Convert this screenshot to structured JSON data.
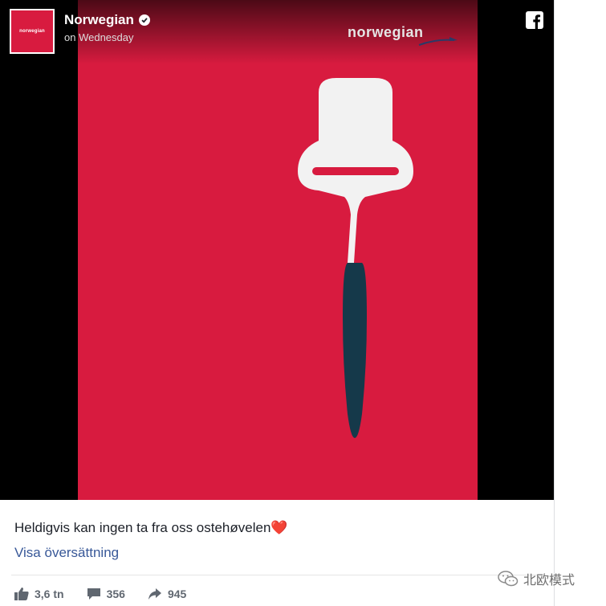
{
  "post": {
    "page_name": "Norwegian",
    "timestamp": "on Wednesday",
    "avatar_wordmark": "norwegian",
    "caption": "Heldigvis kan ingen ta fra oss ostehøvelen❤️",
    "translate_link": "Visa översättning",
    "likes": "3,6 tn",
    "comments": "356",
    "shares": "945"
  },
  "poster": {
    "brand_logo": "norwegian",
    "background_color": "#d81b3f",
    "handle_color": "#15394a"
  },
  "icons": {
    "facebook": "facebook-icon",
    "verified": "verified-badge-icon",
    "like": "thumbs-up-icon",
    "comment": "comment-bubble-icon",
    "share": "share-arrow-icon",
    "wechat": "wechat-icon"
  },
  "watermark": {
    "text": "北欧模式"
  }
}
